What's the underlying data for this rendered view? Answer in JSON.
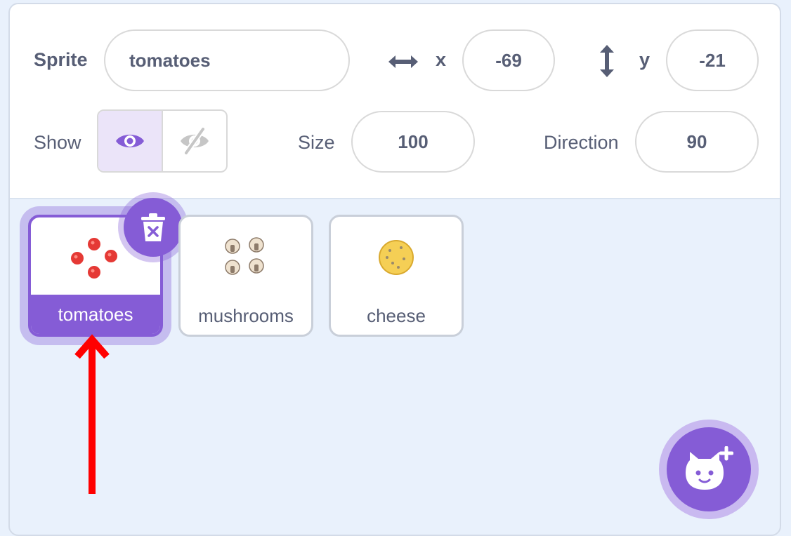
{
  "sprite_info": {
    "sprite_label": "Sprite",
    "sprite_name": "tomatoes",
    "x_label": "x",
    "x_value": "-69",
    "y_label": "y",
    "y_value": "-21",
    "show_label": "Show",
    "visible": true,
    "size_label": "Size",
    "size_value": "100",
    "direction_label": "Direction",
    "direction_value": "90"
  },
  "sprites": [
    {
      "name": "tomatoes",
      "selected": true,
      "thumb_icon": "tomato-slices-icon"
    },
    {
      "name": "mushrooms",
      "selected": false,
      "thumb_icon": "mushroom-slices-icon"
    },
    {
      "name": "cheese",
      "selected": false,
      "thumb_icon": "cheese-icon"
    }
  ],
  "icons": {
    "x_axis": "horizontal-arrows-icon",
    "y_axis": "vertical-arrows-icon",
    "show": "eye-icon",
    "hide": "eye-slash-icon",
    "delete": "trash-icon",
    "add_sprite": "cat-plus-icon",
    "annotation": "red-arrow-annotation"
  },
  "colors": {
    "accent": "#855cd6",
    "text": "#575e75",
    "background": "#e9f1fc",
    "annotation": "#ff0000"
  }
}
